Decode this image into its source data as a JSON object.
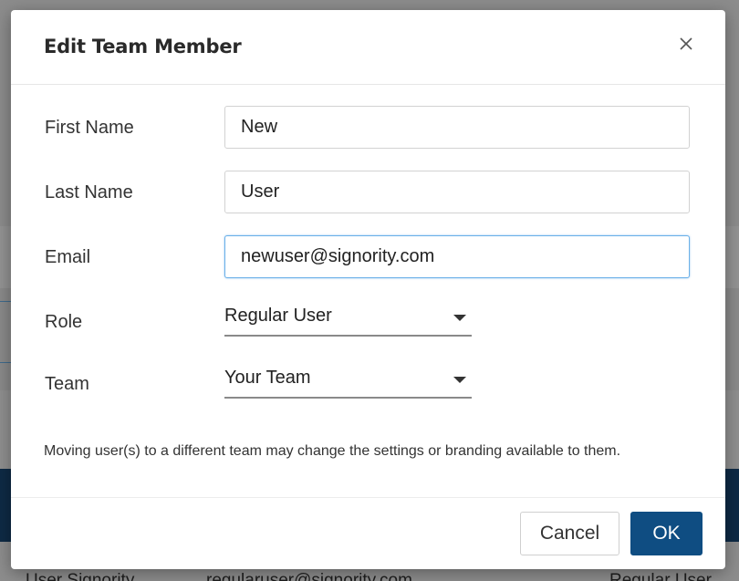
{
  "dialog": {
    "title": "Edit Team Member",
    "close_icon": "close-icon"
  },
  "form": {
    "first_name": {
      "label": "First Name",
      "value": "New"
    },
    "last_name": {
      "label": "Last Name",
      "value": "User"
    },
    "email": {
      "label": "Email",
      "value": "newuser@signority.com"
    },
    "role": {
      "label": "Role",
      "selected": "Regular User"
    },
    "team": {
      "label": "Team",
      "selected": "Your Team"
    },
    "help_text": "Moving user(s) to a different team may change the settings or branding available to them."
  },
  "footer": {
    "cancel_label": "Cancel",
    "ok_label": "OK"
  },
  "background": {
    "row_name": "User Signority",
    "row_email": "regularuser@signority.com",
    "row_role": "Regular User"
  },
  "colors": {
    "primary": "#0f4d82",
    "focus": "#6ab0e8",
    "overlay": "#8f8f8f"
  }
}
